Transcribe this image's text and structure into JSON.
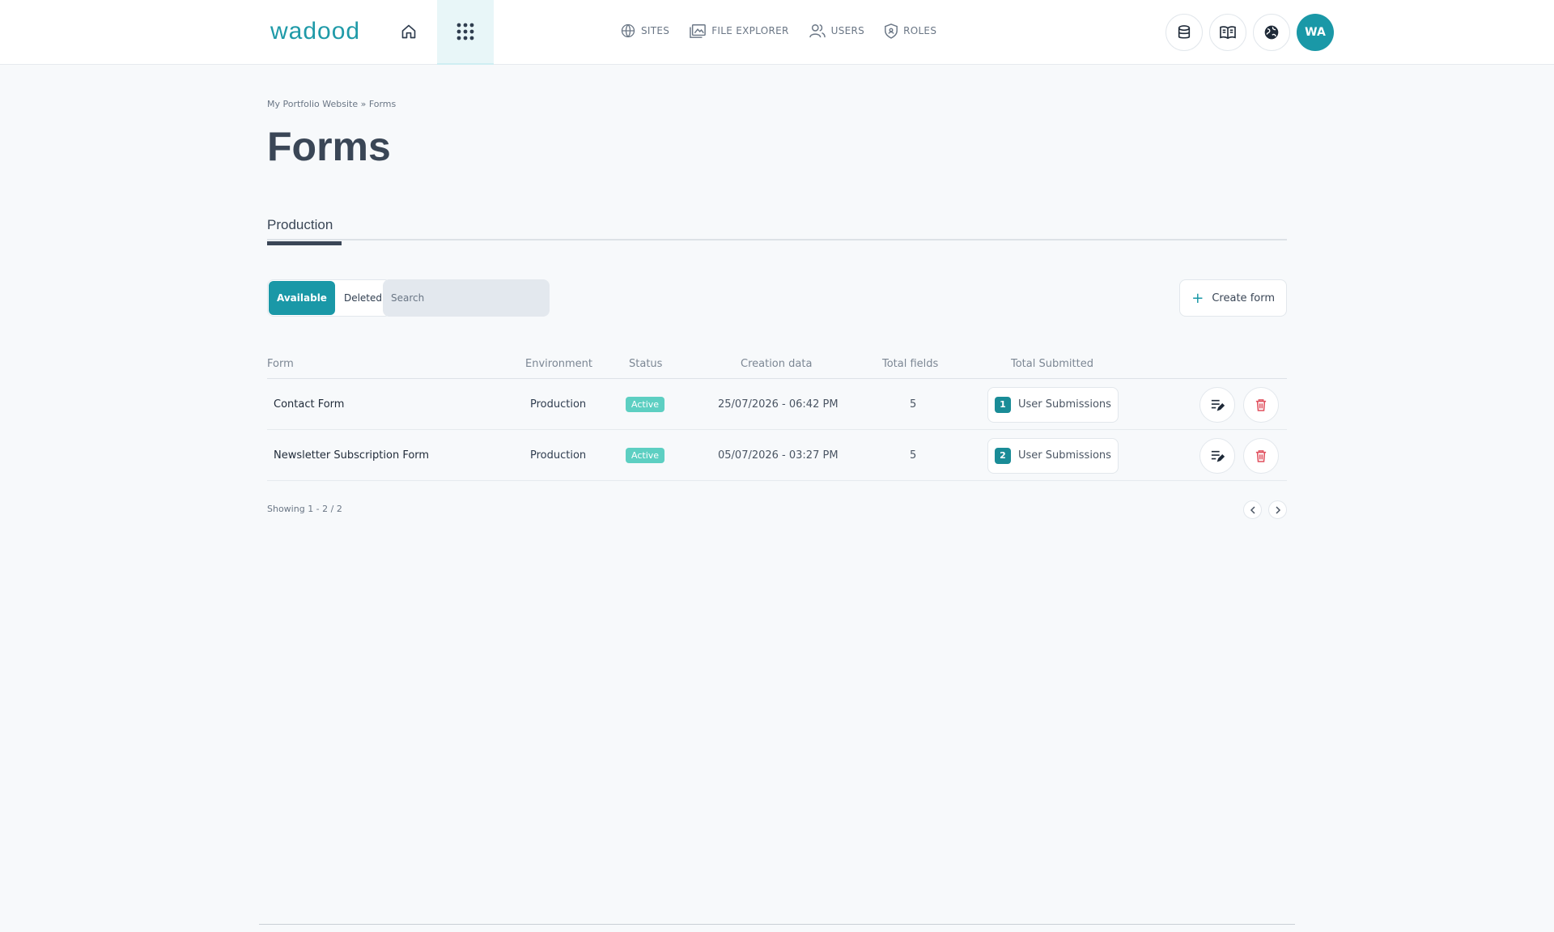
{
  "app": {
    "logo_text": "wadood",
    "avatar_initials": "WA"
  },
  "nav": [
    {
      "label": "SITES",
      "icon": "globe-icon"
    },
    {
      "label": "FILE EXPLORER",
      "icon": "file-explorer-icon"
    },
    {
      "label": "USERS",
      "icon": "users-icon"
    },
    {
      "label": "ROLES",
      "icon": "shield-icon"
    }
  ],
  "breadcrumb": "My Portfolio Website » Forms",
  "page_title": "Forms",
  "tabs": [
    {
      "label": "Production"
    }
  ],
  "toolbar": {
    "filters": [
      {
        "label": "Available",
        "active": true
      },
      {
        "label": "Deleted",
        "active": false
      }
    ],
    "search_placeholder": "Search",
    "create_label": "Create form"
  },
  "table": {
    "headers": [
      "Form",
      "Environment",
      "Status",
      "Creation data",
      "Total fields",
      "Total Submitted"
    ],
    "rows": [
      {
        "form": "Contact Form",
        "environment": "Production",
        "status": "Active",
        "created": "25/07/2026 - 06:42 PM",
        "fields": "5",
        "submitted_count": "1",
        "submitted_label": "User Submissions"
      },
      {
        "form": "Newsletter Subscription Form",
        "environment": "Production",
        "status": "Active",
        "created": "05/07/2026 - 03:27 PM",
        "fields": "5",
        "submitted_count": "2",
        "submitted_label": "User Submissions"
      }
    ]
  },
  "pagination": {
    "showing": "Showing 1 - 2 / 2"
  },
  "colors": {
    "accent": "#1a98a7",
    "status_active": "#5dcfc2",
    "delete": "#e0505e"
  }
}
